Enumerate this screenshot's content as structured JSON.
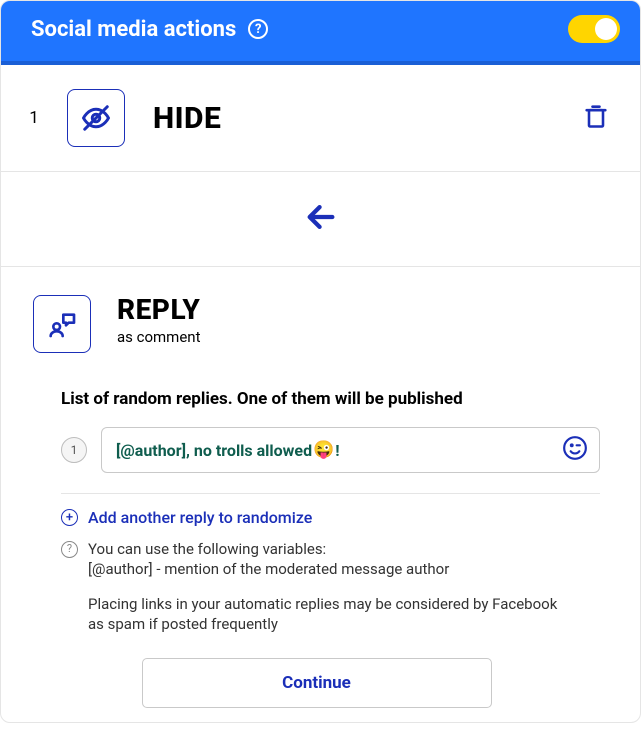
{
  "header": {
    "title": "Social media actions",
    "toggle_on": true
  },
  "hide_action": {
    "index": "1",
    "label": "HIDE"
  },
  "reply_block": {
    "title": "REPLY",
    "subtitle": "as comment",
    "list_header": "List of random replies. One of them will be published",
    "replies": [
      {
        "index": "1",
        "text_pre": "[@author], no trolls allowed ",
        "emoji": "😜",
        "text_post": "!"
      }
    ],
    "add_label": "Add another reply to randomize",
    "help_line1": "You can use the following variables:",
    "help_line2": "[@author] - mention of the moderated message author",
    "note": "Placing links in your automatic replies may be considered by Facebook as spam if posted frequently",
    "continue_label": "Continue"
  }
}
